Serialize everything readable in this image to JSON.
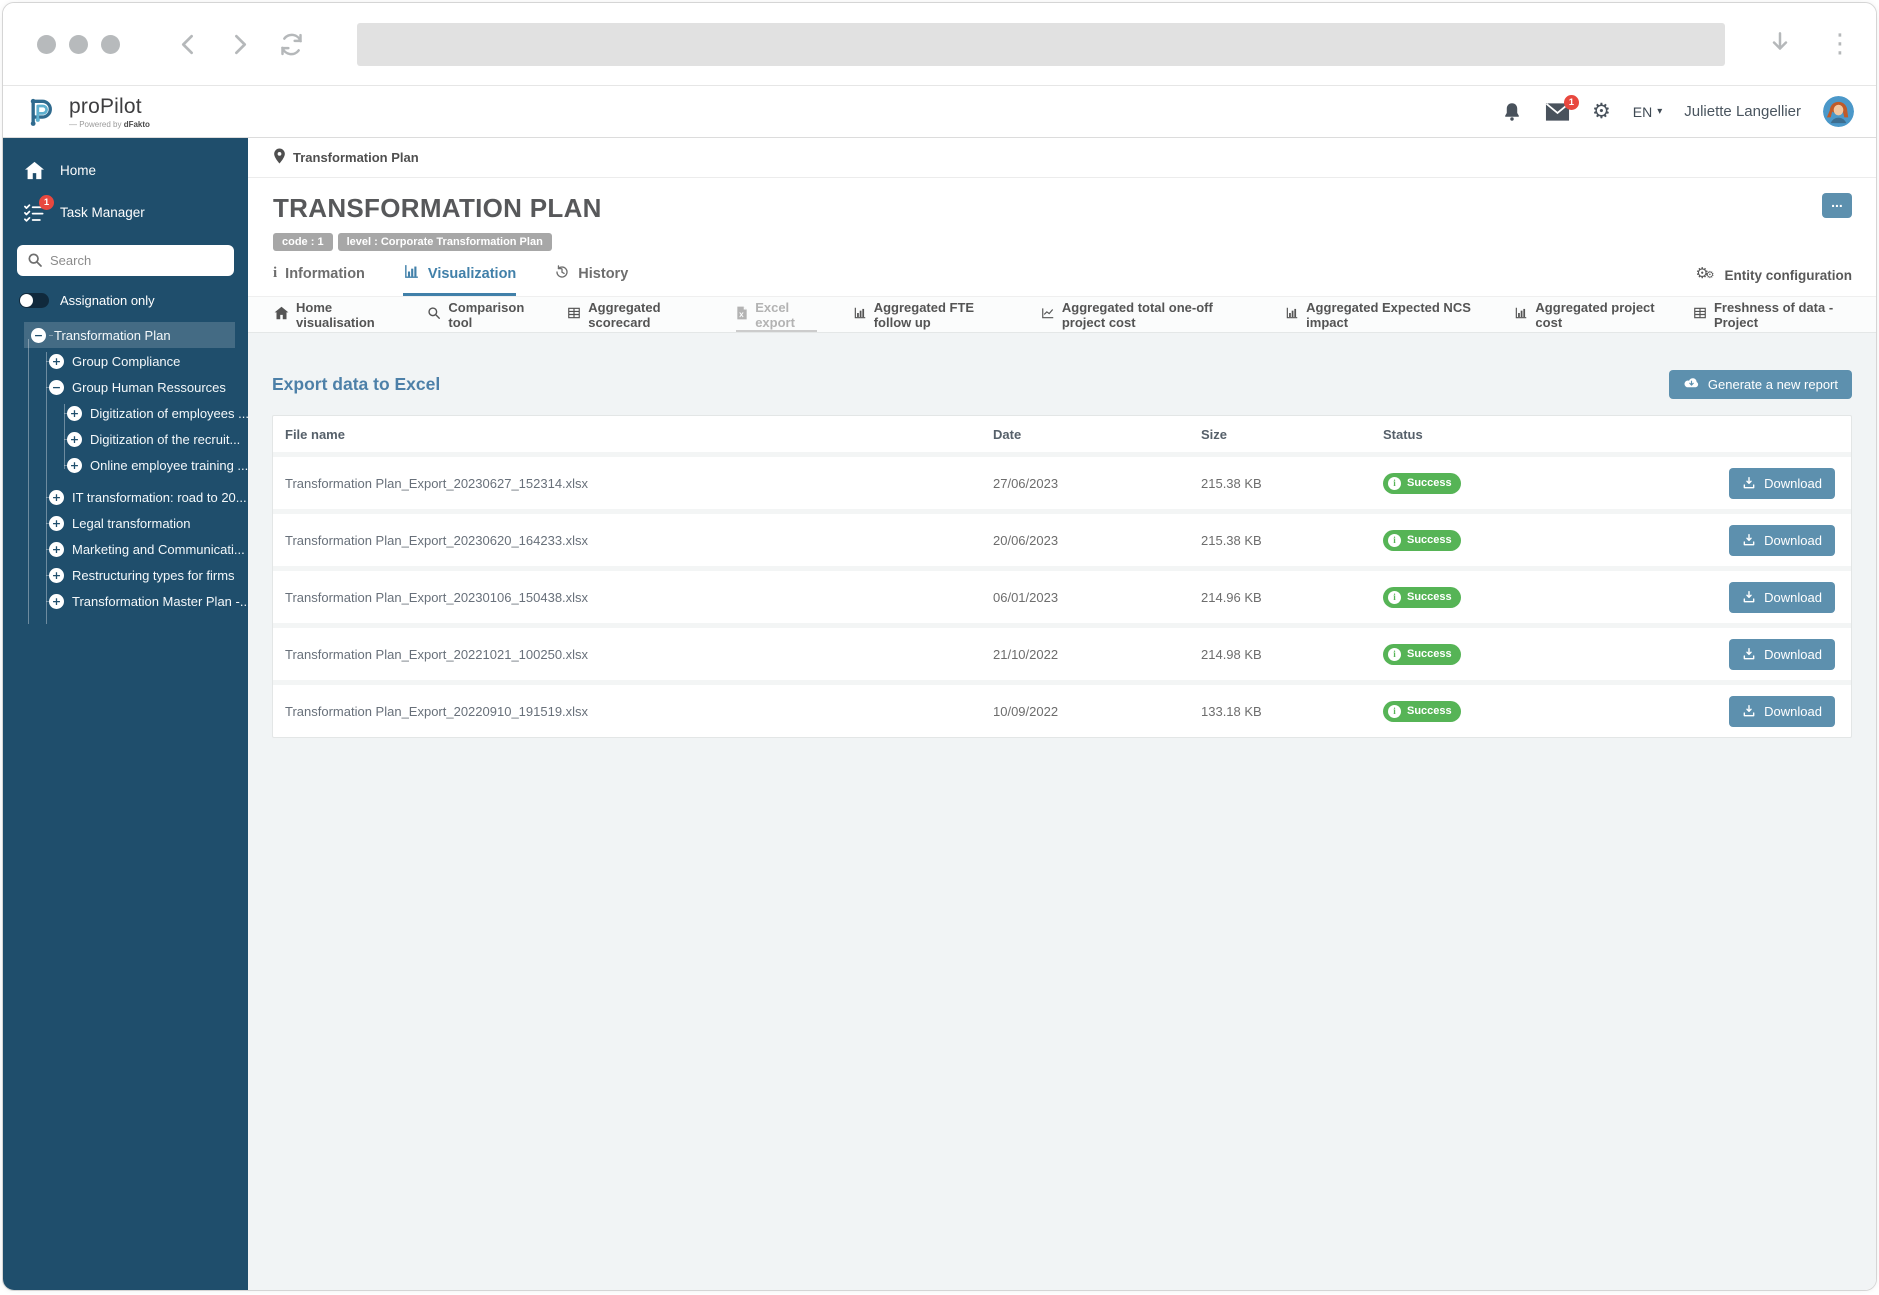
{
  "header": {
    "logo_name": "proPilot",
    "logo_powered_prefix": "— Powered by ",
    "logo_powered_brand": "dFakto",
    "mail_badge": "1",
    "lang": "EN",
    "user_name": "Juliette Langellier"
  },
  "sidebar": {
    "home": "Home",
    "task_manager": "Task Manager",
    "task_badge": "1",
    "search_placeholder": "Search",
    "assignation_label": "Assignation only",
    "tree_labels": [
      "Transformation Plan",
      "Group Compliance",
      "Group Human Ressources",
      "Digitization of employees ...",
      "Digitization of the recruit...",
      "Online employee training ...",
      "IT transformation: road to 20...",
      "Legal transformation",
      "Marketing and Communicati...",
      "Restructuring types for firms",
      "Transformation Master Plan -..."
    ]
  },
  "main": {
    "breadcrumb": "Transformation Plan",
    "title": "TRANSFORMATION PLAN",
    "badges": [
      "code : 1",
      "level : Corporate Transformation Plan"
    ],
    "tabs": [
      {
        "label": "Information"
      },
      {
        "label": "Visualization"
      },
      {
        "label": "History"
      }
    ],
    "entity_config": "Entity configuration",
    "subtabs": [
      {
        "label": "Home visualisation"
      },
      {
        "label": "Comparison tool"
      },
      {
        "label": "Aggregated scorecard"
      },
      {
        "label": "Excel export"
      },
      {
        "label": "Aggregated FTE follow up"
      },
      {
        "label": "Aggregated total one-off project cost"
      },
      {
        "label": "Aggregated Expected NCS impact"
      },
      {
        "label": "Aggregated project cost"
      },
      {
        "label": "Freshness of data - Project"
      }
    ],
    "section_title": "Export data to Excel",
    "generate_button": "Generate a new report",
    "table": {
      "headers": [
        "File name",
        "Date",
        "Size",
        "Status"
      ],
      "rows": [
        {
          "file": "Transformation Plan_Export_20230627_152314.xlsx",
          "date": "27/06/2023",
          "size": "215.38 KB",
          "status": "Success",
          "action": "Download"
        },
        {
          "file": "Transformation Plan_Export_20230620_164233.xlsx",
          "date": "20/06/2023",
          "size": "215.38 KB",
          "status": "Success",
          "action": "Download"
        },
        {
          "file": "Transformation Plan_Export_20230106_150438.xlsx",
          "date": "06/01/2023",
          "size": "214.96 KB",
          "status": "Success",
          "action": "Download"
        },
        {
          "file": "Transformation Plan_Export_20221021_100250.xlsx",
          "date": "21/10/2022",
          "size": "214.98 KB",
          "status": "Success",
          "action": "Download"
        },
        {
          "file": "Transformation Plan_Export_20220910_191519.xlsx",
          "date": "10/09/2022",
          "size": "133.18 KB",
          "status": "Success",
          "action": "Download"
        }
      ]
    }
  },
  "icons": {
    "gear": "⚙",
    "gear_small": "⚙",
    "caret_down": "▾",
    "ellipsis": "...",
    "kebab": "⋮",
    "plus": "+",
    "minus": "−",
    "info": "i"
  },
  "colors": {
    "accent_button": "#5d90ae",
    "sidebar_bg": "#1f4e6c",
    "active_tab": "#4180a9",
    "success_green": "#56b456",
    "alert_red": "#e8483f",
    "heading_blue": "#4d80a8"
  }
}
